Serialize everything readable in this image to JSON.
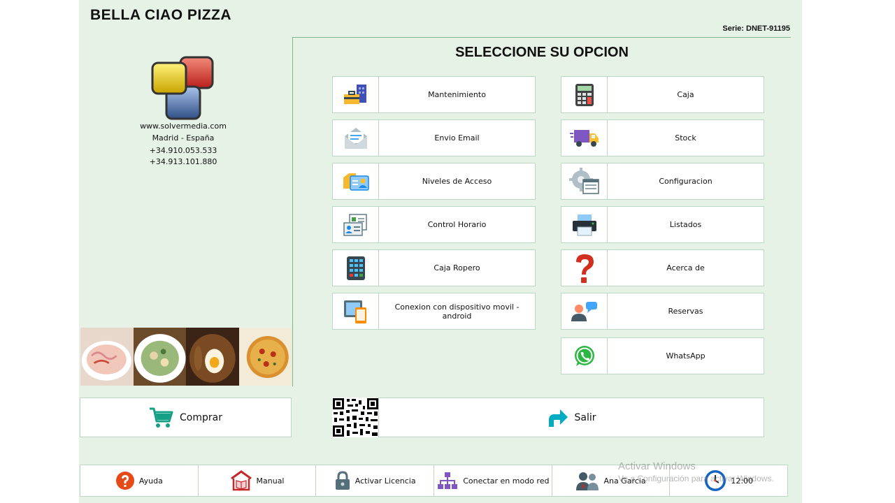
{
  "app": {
    "title": "BELLA CIAO PIZZA",
    "serie": "Serie: DNET-91195"
  },
  "company": {
    "website": "www.solvermedia.com",
    "location": "Madrid - España",
    "phone1": "+34.910.053.533",
    "phone2": "+34.913.101.880"
  },
  "main": {
    "heading": "SELECCIONE SU OPCION",
    "left_options": [
      {
        "label": "Mantenimiento",
        "icon": "toolbox-building-icon"
      },
      {
        "label": "Envio Email",
        "icon": "email-envelope-icon"
      },
      {
        "label": "Niveles de Acceso",
        "icon": "id-card-icon"
      },
      {
        "label": "Control Horario",
        "icon": "time-card-icon"
      },
      {
        "label": "Caja Ropero",
        "icon": "keypad-icon"
      },
      {
        "label": "Conexion con dispositivo movil - android",
        "icon": "mobile-device-icon"
      }
    ],
    "right_options": [
      {
        "label": "Caja",
        "icon": "calculator-icon"
      },
      {
        "label": "Stock",
        "icon": "delivery-truck-icon"
      },
      {
        "label": "Configuracion",
        "icon": "settings-gear-icon"
      },
      {
        "label": "Listados",
        "icon": "printer-icon"
      },
      {
        "label": "Acerca de",
        "icon": "question-mark-icon"
      },
      {
        "label": "Reservas",
        "icon": "people-chat-icon"
      },
      {
        "label": "WhatsApp",
        "icon": "whatsapp-icon"
      }
    ],
    "buy_label": "Comprar",
    "exit_label": "Salir"
  },
  "bottom_bar": [
    {
      "label": "Ayuda",
      "icon": "help-icon"
    },
    {
      "label": "Manual",
      "icon": "manual-book-icon"
    },
    {
      "label": "Activar Licencia",
      "icon": "lock-icon"
    },
    {
      "label": "Conectar en modo red",
      "icon": "network-icon"
    },
    {
      "label": "Ana Garcia",
      "icon": "users-icon"
    },
    {
      "label": "12:00",
      "icon": "clock-icon"
    }
  ],
  "watermark": {
    "line1": "Activar Windows",
    "line2": "Ve a Configuración para activar Windows."
  },
  "colors": {
    "background": "#e6f2e6",
    "border": "#b9d9c3",
    "accent_green": "#7fb48f"
  }
}
